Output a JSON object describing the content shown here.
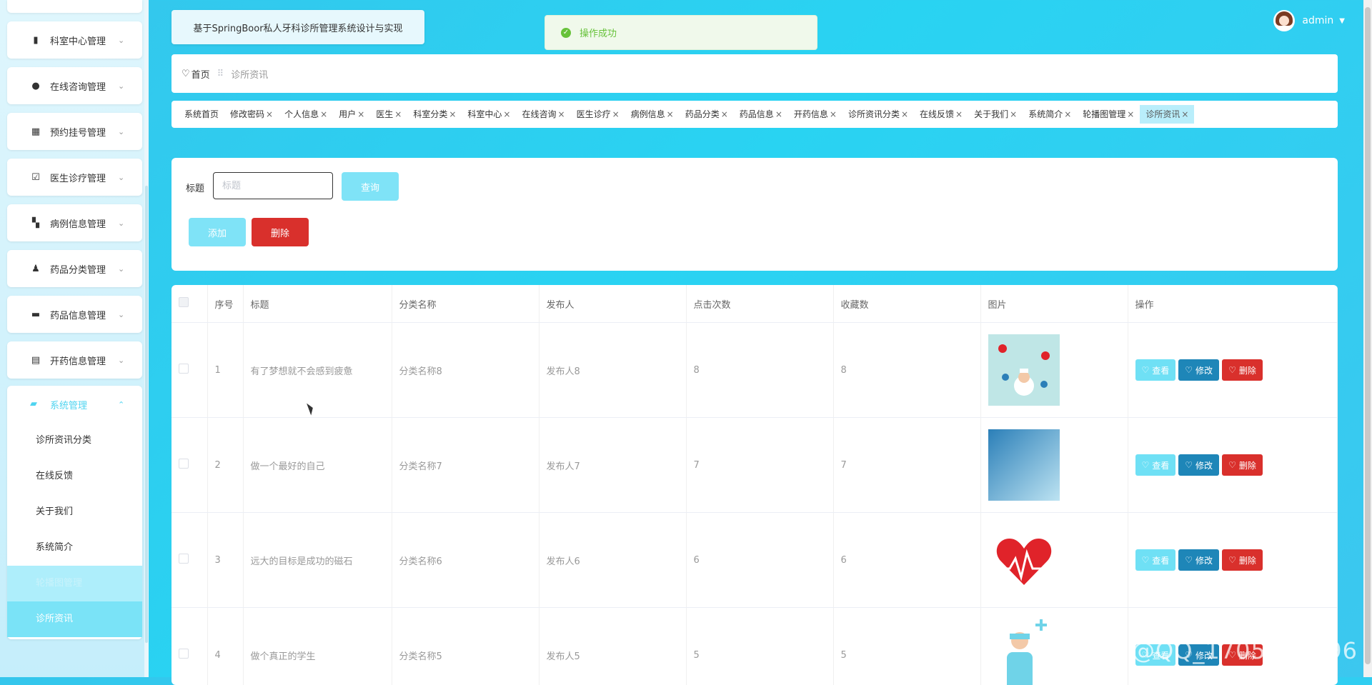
{
  "app_title": "基于SpringBoor私人牙科诊所管理系统设计与实现",
  "toast": "操作成功",
  "user": {
    "name": "admin"
  },
  "sidebar": {
    "menus": [
      {
        "label": "科室中心管理",
        "icon": "building-icon"
      },
      {
        "label": "在线咨询管理",
        "icon": "location-pin-icon"
      },
      {
        "label": "预约挂号管理",
        "icon": "grid-icon"
      },
      {
        "label": "医生诊疗管理",
        "icon": "clipboard-check-icon"
      },
      {
        "label": "病例信息管理",
        "icon": "dashboard-icon"
      },
      {
        "label": "药品分类管理",
        "icon": "user-icon"
      },
      {
        "label": "药品信息管理",
        "icon": "briefcase-icon"
      },
      {
        "label": "开药信息管理",
        "icon": "clipboard-icon"
      }
    ],
    "system": {
      "label": "系统管理",
      "items": [
        "诊所资讯分类",
        "在线反馈",
        "关于我们",
        "系统简介",
        "轮播图管理",
        "诊所资讯"
      ]
    }
  },
  "breadcrumb": {
    "home": "首页",
    "current": "诊所资讯"
  },
  "tags": [
    "系统首页",
    "修改密码",
    "个人信息",
    "用户",
    "医生",
    "科室分类",
    "科室中心",
    "在线咨询",
    "医生诊疗",
    "病例信息",
    "药品分类",
    "药品信息",
    "开药信息",
    "诊所资讯分类",
    "在线反馈",
    "关于我们",
    "系统简介",
    "轮播图管理",
    "诊所资讯"
  ],
  "search": {
    "label": "标题",
    "placeholder": "标题",
    "query_label": "查询",
    "add_label": "添加",
    "delete_label": "删除"
  },
  "table": {
    "columns": [
      "序号",
      "标题",
      "分类名称",
      "发布人",
      "点击次数",
      "收藏数",
      "图片",
      "操作"
    ],
    "rows": [
      {
        "no": "1",
        "title": "有了梦想就不会感到疲惫",
        "category": "分类名称8",
        "publisher": "发布人8",
        "clicks": "8",
        "favorites": "8"
      },
      {
        "no": "2",
        "title": "做一个最好的自己",
        "category": "分类名称7",
        "publisher": "发布人7",
        "clicks": "7",
        "favorites": "7"
      },
      {
        "no": "3",
        "title": "远大的目标是成功的磁石",
        "category": "分类名称6",
        "publisher": "发布人6",
        "clicks": "6",
        "favorites": "6"
      },
      {
        "no": "4",
        "title": "做个真正的学生",
        "category": "分类名称5",
        "publisher": "发布人5",
        "clicks": "5",
        "favorites": "5"
      }
    ],
    "actions": {
      "view": "查看",
      "edit": "修改",
      "delete": "删除"
    }
  },
  "watermark": "CSDN @QQ_1705806396"
}
